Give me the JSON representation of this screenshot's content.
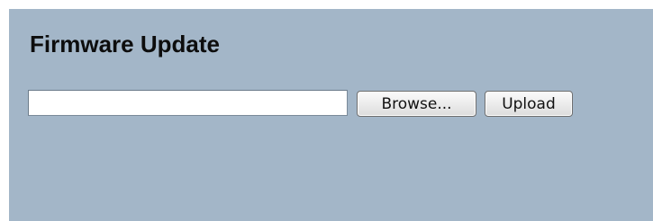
{
  "page": {
    "title": "Firmware Update"
  },
  "file_picker": {
    "value": "",
    "browse_label": "Browse..."
  },
  "actions": {
    "upload_label": "Upload"
  },
  "colors": {
    "panel_background": "#a3b6c8",
    "page_background": "#ffffff",
    "title_text": "#0d0d0d"
  }
}
